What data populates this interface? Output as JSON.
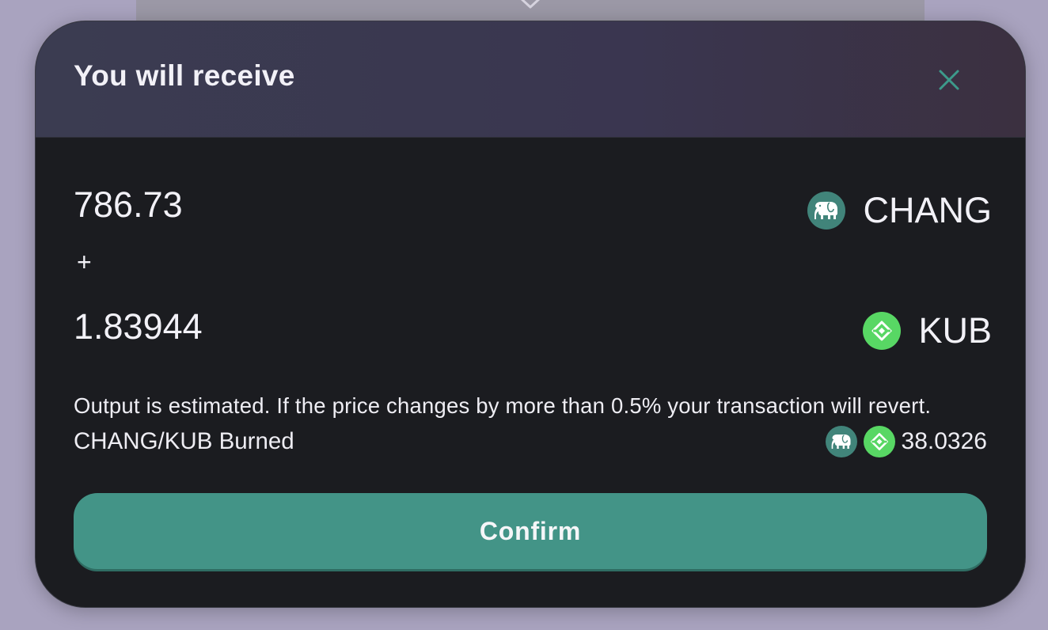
{
  "modal": {
    "title": "You will receive",
    "close_icon": "close-icon",
    "accent_color": "#439487"
  },
  "receive": [
    {
      "amount": "786.73",
      "token": "CHANG",
      "icon": "elephant-icon",
      "icon_bg": "#41847a"
    },
    {
      "amount": "1.83944",
      "token": "KUB",
      "icon": "kub-logo-icon",
      "icon_bg": "#58d764"
    }
  ],
  "separator": "+",
  "note": "Output is estimated. If the price changes by more than 0.5% your transaction will revert.",
  "burned": {
    "label": "CHANG/KUB Burned",
    "value": "38.0326"
  },
  "confirm_label": "Confirm"
}
